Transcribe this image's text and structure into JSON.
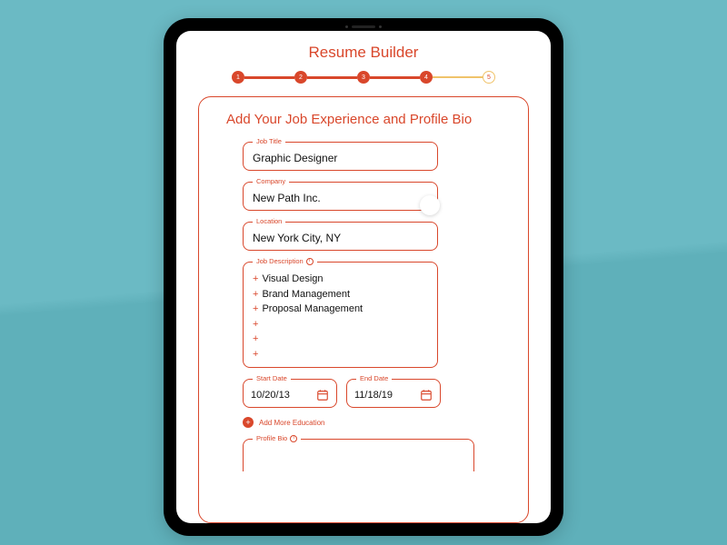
{
  "app": {
    "title": "Resume Builder"
  },
  "stepper": {
    "steps": [
      "1",
      "2",
      "3",
      "4",
      "5"
    ],
    "current": 4
  },
  "section": {
    "title": "Add Your Job Experience and Profile Bio"
  },
  "fields": {
    "job_title": {
      "label": "Job Title",
      "value": "Graphic Designer"
    },
    "company": {
      "label": "Company",
      "value": "New Path Inc."
    },
    "location": {
      "label": "Location",
      "value": "New York City, NY"
    },
    "job_description": {
      "label": "Job Description",
      "items": [
        "Visual Design",
        "Brand Management",
        "Proposal Management"
      ],
      "empty_slots": 3
    },
    "start_date": {
      "label": "Start Date",
      "value": "10/20/13"
    },
    "end_date": {
      "label": "End Date",
      "value": "11/18/19"
    },
    "profile_bio": {
      "label": "Profile Bio",
      "value": ""
    }
  },
  "actions": {
    "add_more_label": "Add More Education"
  },
  "colors": {
    "accent": "#d9472b",
    "accent_light": "#f0c36a",
    "bg": "#6bbac4"
  }
}
